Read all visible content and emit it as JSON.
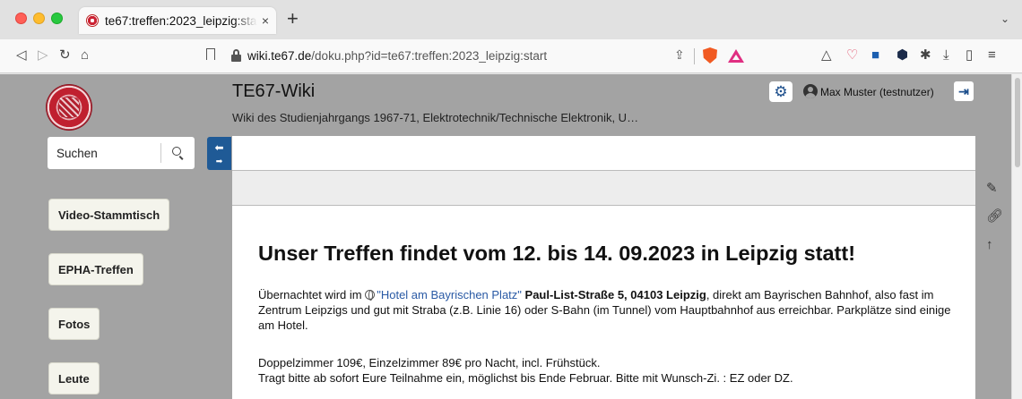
{
  "browser": {
    "tab_title": "te67:treffen:2023_leipzig:start",
    "tab_close": "×",
    "new_tab": "+",
    "tab_menu": "⌄",
    "url_domain": "wiki.te67.de",
    "url_path": "/doku.php?id=te67:treffen:2023_leipzig:start"
  },
  "header": {
    "site_title": "TE67-Wiki",
    "tagline": "Wiki des Studienjahrgangs 1967-71, Elektrotechnik/Technische Elektronik, U…",
    "user_name": "Max Muster (testnutzer)"
  },
  "search": {
    "placeholder": "Suchen"
  },
  "sidebar": {
    "items": [
      {
        "label": "Video-Stammtisch"
      },
      {
        "label": "EPHA-Treffen"
      },
      {
        "label": "Fotos"
      },
      {
        "label": "Leute"
      }
    ]
  },
  "content": {
    "heading": "Unser Treffen findet vom 12. bis 14. 09.2023 in Leipzig statt!",
    "p1_before": "Übernachtet wird im ",
    "hotel_link": "\"Hotel am Bayrischen Platz\"",
    "address": "Paul-List-Straße 5, 04103 Leipzig",
    "p1_after": ", direkt am Bayrischen Bahnhof, also fast im Zentrum Leipzigs und gut mit Straba (z.B. Linie 16) oder S-Bahn (im Tunnel) vom Hauptbahnhof aus erreichbar. Parkplätze sind einige am Hotel.",
    "p2_line1": "Doppelzimmer 109€, Einzelzimmer 89€ pro Nacht, incl. Frühstück.",
    "p2_line2": "Tragt bitte ab sofort Eure Teilnahme ein, möglichst bis Ende Februar. Bitte mit Wunsch-Zi. : EZ oder DZ."
  },
  "colors": {
    "page_background": "#a3a3a3",
    "accent_blue": "#1f5a96",
    "link": "#2a5aa5"
  }
}
